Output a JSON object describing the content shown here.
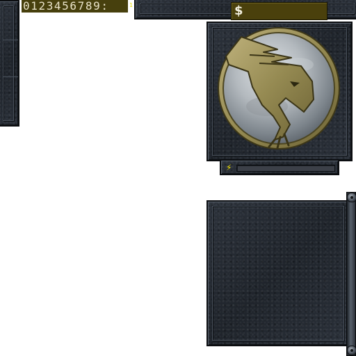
{
  "hud": {
    "digit_strip": "0123456789:",
    "tiny_marker": "1"
  },
  "credits": {
    "currency_symbol": "$"
  },
  "power": {
    "icon": "lightning-icon",
    "level": 0
  },
  "logo": {
    "icon": "eagle-emblem-icon"
  },
  "colors": {
    "panel": "#262b33",
    "credits_bg": "#4a400c",
    "digit_bg": "#47400d",
    "emblem_gold": "#9a8d52",
    "emblem_metal": "#b9bfc4",
    "power_icon": "#f2e200"
  }
}
